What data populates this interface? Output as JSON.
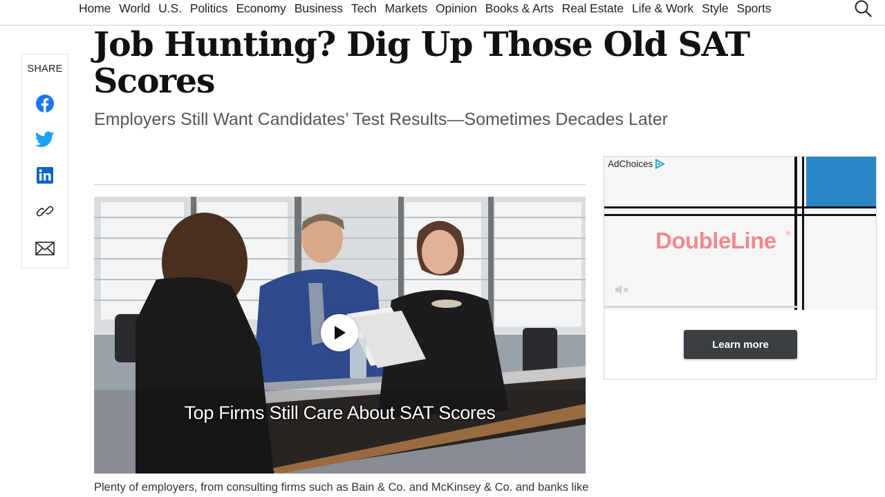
{
  "nav": {
    "items": [
      {
        "label": "Home"
      },
      {
        "label": "World"
      },
      {
        "label": "U.S."
      },
      {
        "label": "Politics"
      },
      {
        "label": "Economy"
      },
      {
        "label": "Business"
      },
      {
        "label": "Tech"
      },
      {
        "label": "Markets"
      },
      {
        "label": "Opinion"
      },
      {
        "label": "Books & Arts"
      },
      {
        "label": "Real Estate"
      },
      {
        "label": "Life & Work"
      },
      {
        "label": "Style"
      },
      {
        "label": "Sports"
      }
    ],
    "search_icon": "search-icon"
  },
  "article": {
    "headline": "Job Hunting? Dig Up Those Old SAT Scores",
    "subheadline": "Employers Still Want Candidates’ Test Results—Sometimes Decades Later",
    "body_first_line": "Plenty of employers, from consulting firms such as Bain & Co. and McKinsey & Co. and banks like"
  },
  "share": {
    "label": "SHARE",
    "buttons": [
      {
        "icon": "facebook-icon",
        "color": "#1877f2"
      },
      {
        "icon": "twitter-icon",
        "color": "#1da1f2"
      },
      {
        "icon": "linkedin-icon",
        "color": "#0a66c2"
      },
      {
        "icon": "link-icon",
        "color": "#222222"
      },
      {
        "icon": "email-icon",
        "color": "#222222"
      }
    ]
  },
  "video": {
    "caption": "Top Firms Still Care About SAT Scores",
    "play_icon": "play-icon"
  },
  "ad": {
    "adchoices_label": "AdChoices",
    "brand": "DoubleLine",
    "registered_mark": "®",
    "cta_label": "Learn more",
    "brand_color": "#ef8a8f",
    "accent_color": "#2b86c5"
  }
}
